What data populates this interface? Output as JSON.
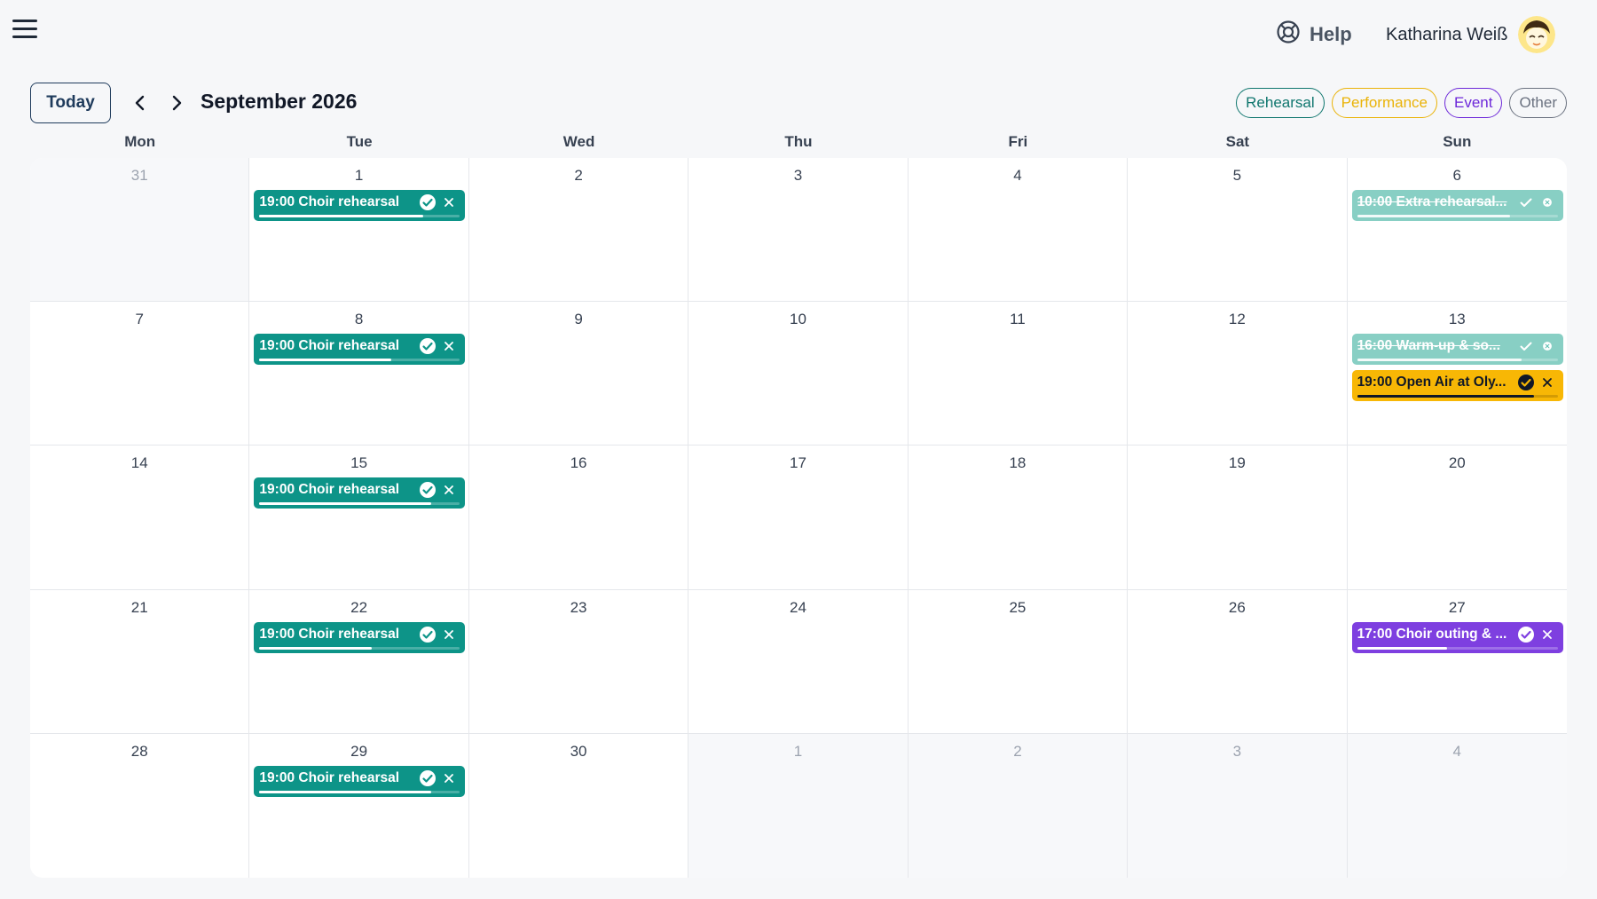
{
  "topbar": {
    "help_label": "Help",
    "user_name": "Katharina Weiß"
  },
  "toolbar": {
    "today_label": "Today",
    "month_title": "September 2026"
  },
  "legend": [
    {
      "label": "Rehearsal",
      "color": "#0f766e"
    },
    {
      "label": "Performance",
      "color": "#eab308"
    },
    {
      "label": "Event",
      "color": "#6d28d9"
    },
    {
      "label": "Other",
      "color": "#6b7280"
    }
  ],
  "weekdays": [
    "Mon",
    "Tue",
    "Wed",
    "Thu",
    "Fri",
    "Sat",
    "Sun"
  ],
  "weeks": [
    [
      {
        "day": "31",
        "muted": true
      },
      {
        "day": "1",
        "events": [
          {
            "title": "19:00 Choir rehearsal",
            "kind": "teal",
            "progress": 0.82
          }
        ]
      },
      {
        "day": "2"
      },
      {
        "day": "3"
      },
      {
        "day": "4"
      },
      {
        "day": "5"
      },
      {
        "day": "6",
        "events": [
          {
            "title": "10:00 Extra rehearsal...",
            "kind": "teal",
            "cancelled": true,
            "progress": 0.76
          }
        ]
      }
    ],
    [
      {
        "day": "7"
      },
      {
        "day": "8",
        "events": [
          {
            "title": "19:00 Choir rehearsal",
            "kind": "teal",
            "progress": 0.66
          }
        ]
      },
      {
        "day": "9"
      },
      {
        "day": "10"
      },
      {
        "day": "11"
      },
      {
        "day": "12"
      },
      {
        "day": "13",
        "events": [
          {
            "title": "16:00 Warm-up & so...",
            "kind": "teal",
            "cancelled": true,
            "progress": 0.82
          },
          {
            "title": "19:00 Open Air at Oly...",
            "kind": "yellow",
            "progress": 0.88
          }
        ]
      }
    ],
    [
      {
        "day": "14"
      },
      {
        "day": "15",
        "events": [
          {
            "title": "19:00 Choir rehearsal",
            "kind": "teal",
            "progress": 0.86
          }
        ]
      },
      {
        "day": "16"
      },
      {
        "day": "17"
      },
      {
        "day": "18"
      },
      {
        "day": "19"
      },
      {
        "day": "20"
      }
    ],
    [
      {
        "day": "21"
      },
      {
        "day": "22",
        "events": [
          {
            "title": "19:00 Choir rehearsal",
            "kind": "teal",
            "progress": 0.56
          }
        ]
      },
      {
        "day": "23"
      },
      {
        "day": "24"
      },
      {
        "day": "25"
      },
      {
        "day": "26"
      },
      {
        "day": "27",
        "events": [
          {
            "title": "17:00 Choir outing & ...",
            "kind": "purple",
            "progress": 0.45
          }
        ]
      }
    ],
    [
      {
        "day": "28"
      },
      {
        "day": "29",
        "events": [
          {
            "title": "19:00 Choir rehearsal",
            "kind": "teal",
            "progress": 0.86
          }
        ]
      },
      {
        "day": "30"
      },
      {
        "day": "1",
        "muted": true
      },
      {
        "day": "2",
        "muted": true
      },
      {
        "day": "3",
        "muted": true
      },
      {
        "day": "4",
        "muted": true
      }
    ]
  ]
}
